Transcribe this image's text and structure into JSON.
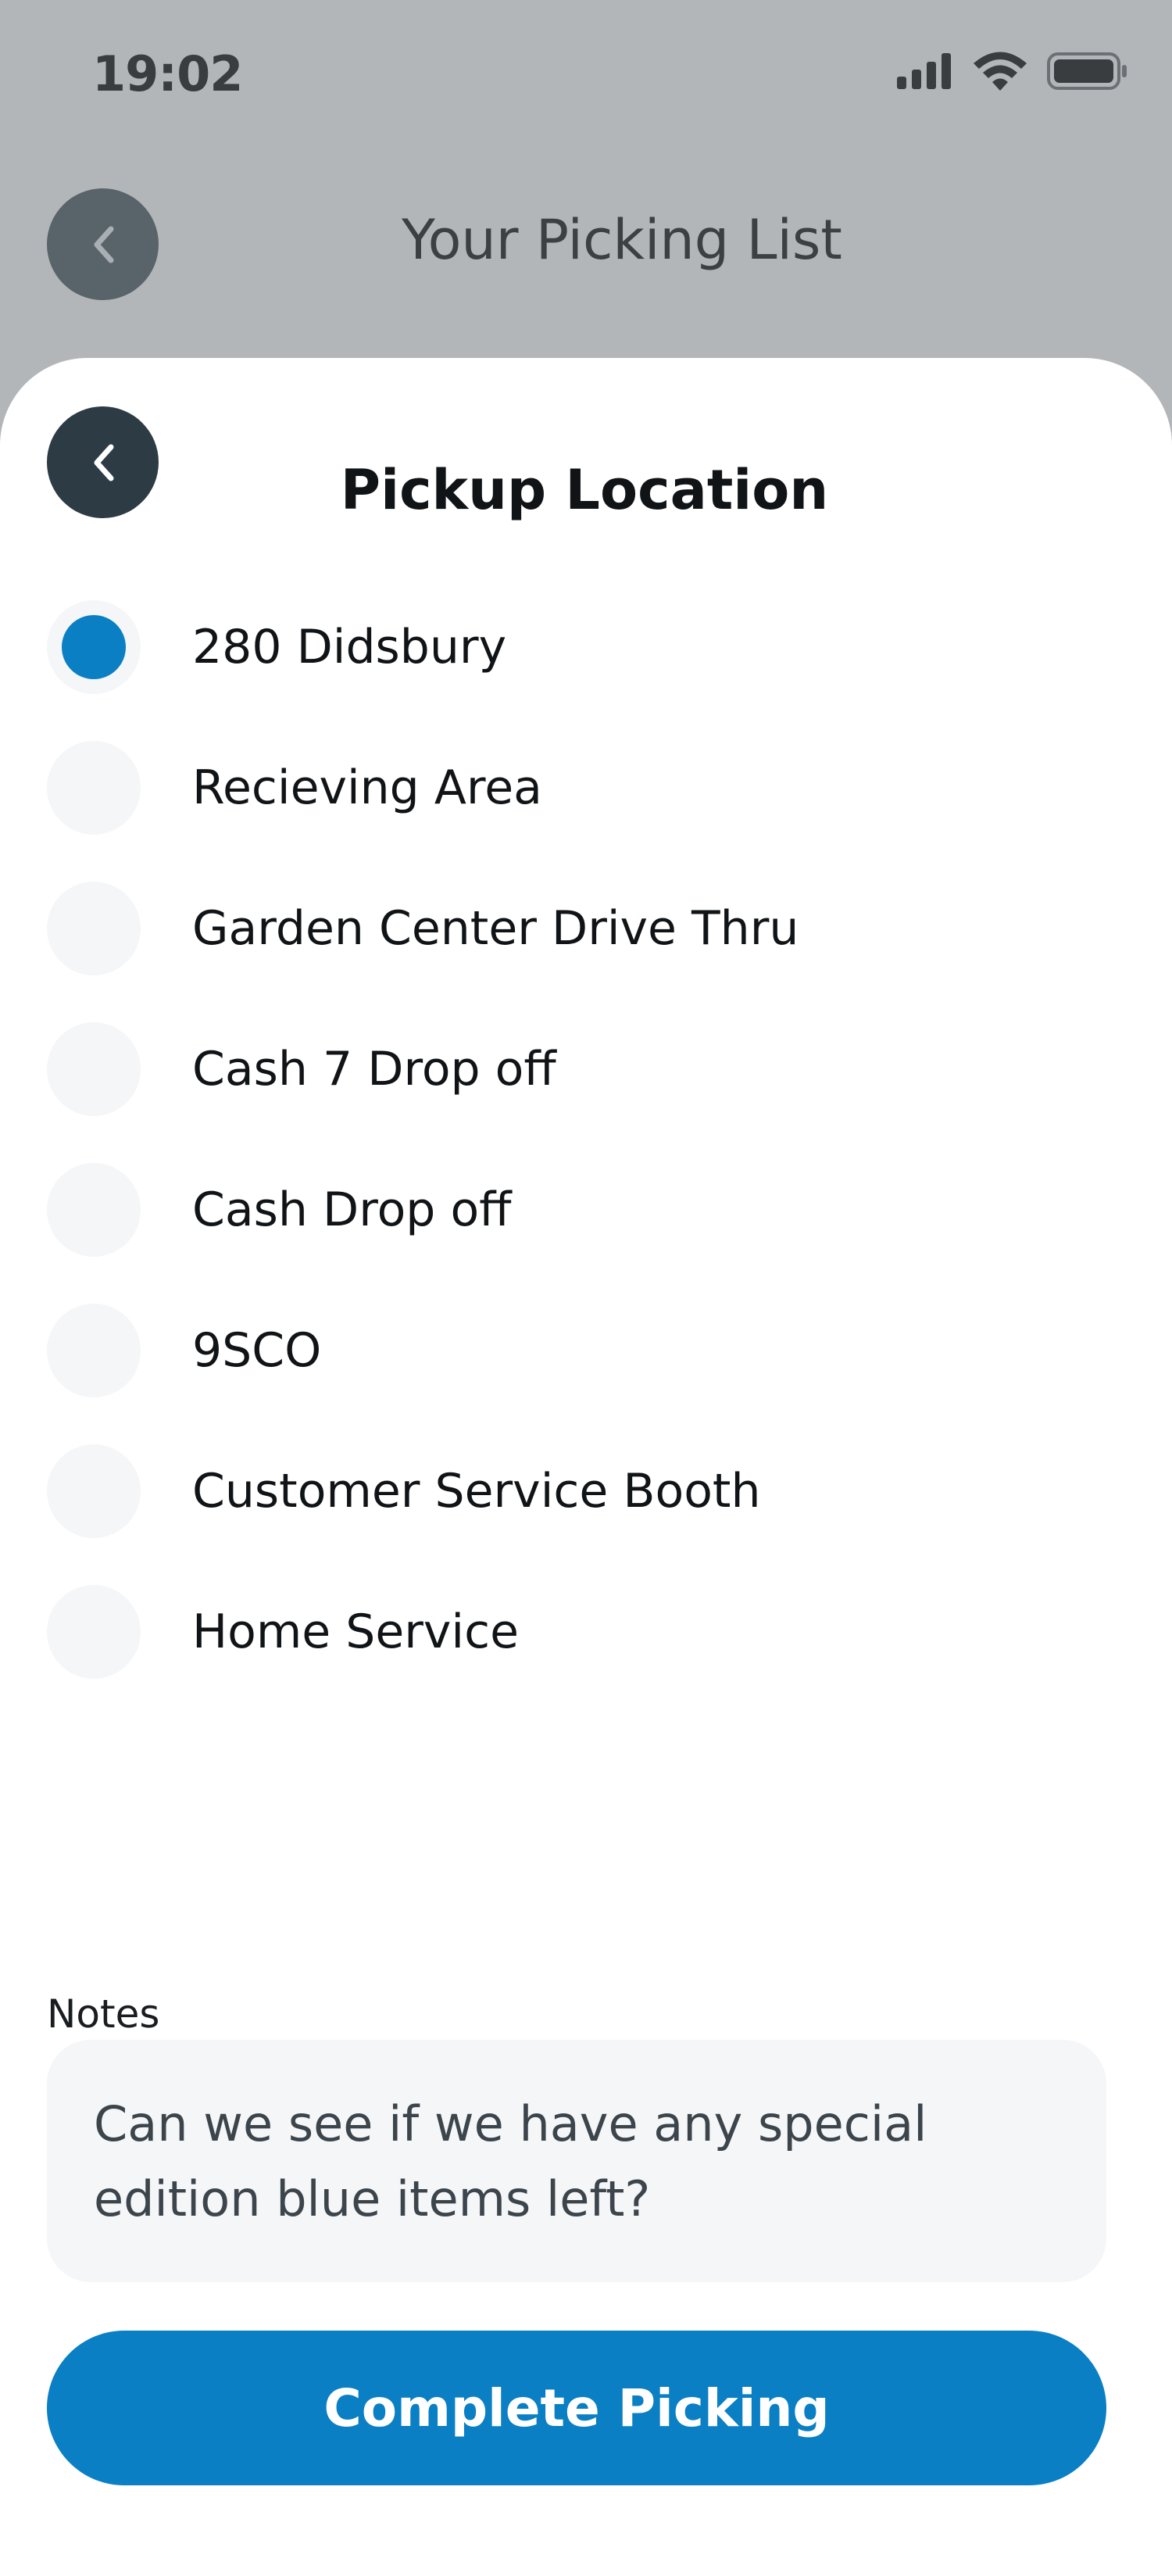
{
  "status_bar": {
    "time": "19:02",
    "icons": [
      "signal-icon",
      "wifi-icon",
      "battery-icon"
    ]
  },
  "header": {
    "title": "Your Picking List",
    "back_icon": "chevron-left-icon"
  },
  "sheet": {
    "title": "Pickup Location",
    "back_icon": "chevron-left-icon",
    "selected_index": 0,
    "options": [
      {
        "label": "280 Didsbury",
        "selected": true
      },
      {
        "label": "Recieving Area",
        "selected": false
      },
      {
        "label": "Garden Center Drive Thru",
        "selected": false
      },
      {
        "label": "Cash 7 Drop off",
        "selected": false
      },
      {
        "label": "Cash Drop off",
        "selected": false
      },
      {
        "label": "9SCO",
        "selected": false
      },
      {
        "label": "Customer Service Booth",
        "selected": false
      },
      {
        "label": "Home Service",
        "selected": false
      }
    ],
    "notes_label": "Notes",
    "notes_value": "Can we see if we have any special edition blue items left?",
    "complete_button": "Complete Picking"
  },
  "colors": {
    "accent": "#0a7fc4",
    "dark_button": "#2d3b44",
    "overlay_bg": "#b3b6b9",
    "field_bg": "#f5f6f8"
  }
}
